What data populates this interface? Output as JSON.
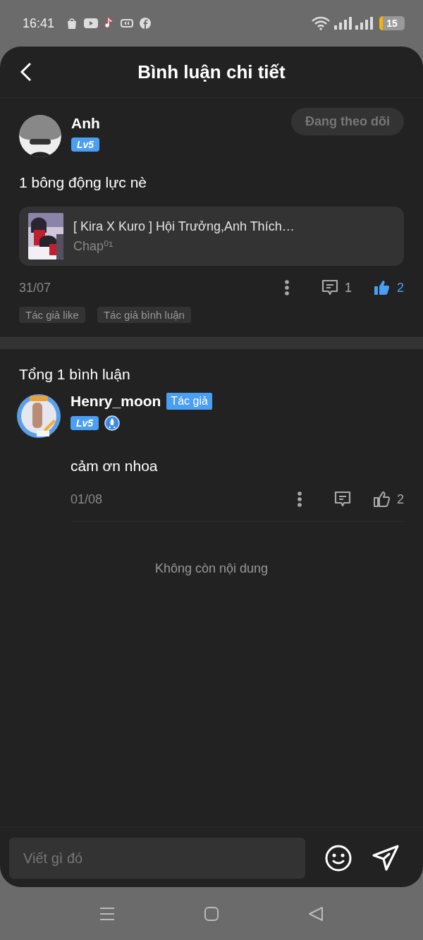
{
  "status_bar": {
    "time": "16:41",
    "battery": "15"
  },
  "header": {
    "title": "Bình luận chi tiết"
  },
  "post": {
    "author": "Anh",
    "level": "Lv5",
    "follow_button": "Đang theo dõi",
    "text": "1 bông động lực nè",
    "work": {
      "title": "[ Kira X Kuro ] Hội Trưởng,Anh Thích…",
      "chapter": "Chap⁰¹"
    },
    "date": "31/07",
    "reply_count": "1",
    "like_count": "2",
    "liked": true,
    "tags": [
      "Tác giả like",
      "Tác giả bình luận"
    ]
  },
  "comments_header": "Tổng 1 bình luận",
  "comments": [
    {
      "author": "Henry_moon",
      "author_badge": "Tác giả",
      "level": "Lv5",
      "text": "cảm ơn nhoa",
      "date": "01/08",
      "like_count": "2",
      "liked": false
    }
  ],
  "end_note": "Không còn nội dung",
  "composer": {
    "placeholder": "Viết gì đó"
  }
}
